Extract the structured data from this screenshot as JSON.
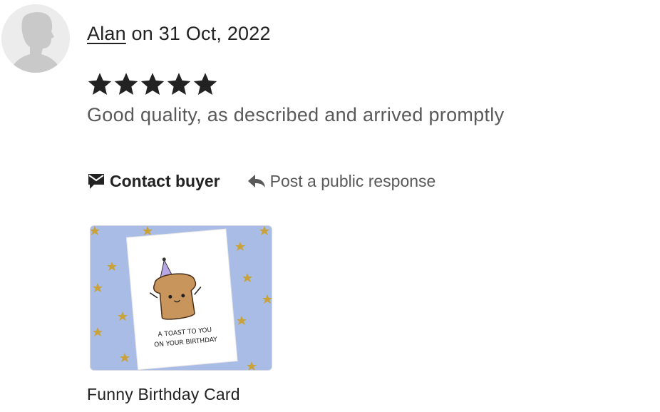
{
  "review": {
    "reviewer_name": "Alan",
    "date_prefix": " on ",
    "date": "31 Oct, 2022",
    "rating": 5,
    "rating_max": 5,
    "text": "Good quality, as described and arrived promptly"
  },
  "actions": {
    "contact_label": "Contact buyer",
    "contact_icon": "envelope-chat-icon",
    "respond_label": "Post a public response",
    "respond_icon": "reply-arrow-icon"
  },
  "product": {
    "title": "Funny Birthday Card",
    "card_text_line1": "A TOAST TO YOU",
    "card_text_line2": "ON YOUR BIRTHDAY",
    "colors": {
      "background": "#a9bce6",
      "toast": "#c8955d",
      "toast_outline": "#4a2f1a"
    }
  },
  "colors": {
    "text": "#222222",
    "muted": "#595959",
    "avatar_bg": "#ececec",
    "avatar_fg": "#c9c9c9"
  }
}
